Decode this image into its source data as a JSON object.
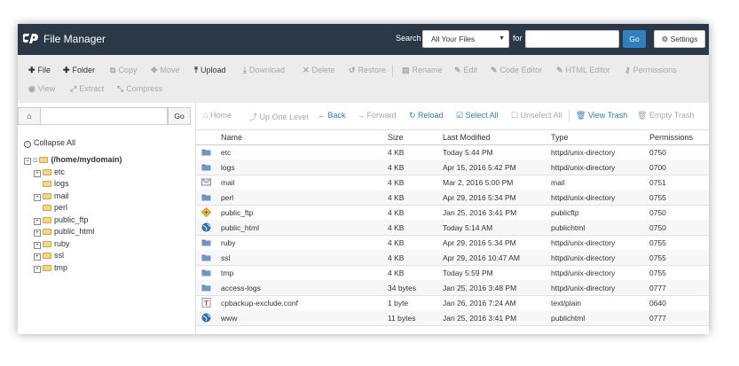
{
  "app": {
    "title": "File Manager",
    "logo": "cpanel-logo"
  },
  "search": {
    "label": "Search",
    "scope_value": "All Your Files",
    "for_label": "for",
    "query": "",
    "go_label": "Go"
  },
  "settings": {
    "label": "Settings",
    "icon": "gear-icon"
  },
  "toolbar": {
    "row1": [
      {
        "icon": "plus-icon",
        "label": "File",
        "enabled": true
      },
      {
        "icon": "plus-icon",
        "label": "Folder",
        "enabled": true
      },
      {
        "icon": "copy-icon",
        "label": "Copy",
        "enabled": false
      },
      {
        "icon": "move-icon",
        "label": "Move",
        "enabled": false
      },
      {
        "icon": "upload-icon",
        "label": "Upload",
        "enabled": true
      },
      {
        "icon": "download-icon",
        "label": "Download",
        "enabled": false
      },
      {
        "icon": "delete-icon",
        "label": "Delete",
        "enabled": false
      },
      {
        "icon": "restore-icon",
        "label": "Restore",
        "enabled": false
      },
      {
        "icon": "rename-icon",
        "label": "Rename",
        "enabled": false
      },
      {
        "icon": "edit-icon",
        "label": "Edit",
        "enabled": false
      },
      {
        "icon": "code-editor-icon",
        "label": "Code Editor",
        "enabled": false
      },
      {
        "icon": "html-editor-icon",
        "label": "HTML Editor",
        "enabled": false
      },
      {
        "icon": "key-icon",
        "label": "Permissions",
        "enabled": false
      }
    ],
    "row2": [
      {
        "icon": "eye-icon",
        "label": "View",
        "enabled": false
      },
      {
        "icon": "extract-icon",
        "label": "Extract",
        "enabled": false
      },
      {
        "icon": "compress-icon",
        "label": "Compress",
        "enabled": false
      }
    ]
  },
  "nav": {
    "path_value": "",
    "go_label": "Go"
  },
  "file_toolbar": [
    {
      "icon": "home-icon",
      "label": "Home",
      "enabled": false
    },
    {
      "icon": "level-up-icon",
      "label": "Up One Level",
      "enabled": false
    },
    {
      "icon": "back-arrow-icon",
      "label": "Back",
      "enabled": true
    },
    {
      "icon": "forward-arrow-icon",
      "label": "Forward",
      "enabled": false
    },
    {
      "icon": "reload-icon",
      "label": "Reload",
      "enabled": true
    },
    {
      "icon": "checkbox-checked-icon",
      "label": "Select All",
      "enabled": true
    },
    {
      "icon": "checkbox-empty-icon",
      "label": "Unselect All",
      "enabled": false
    },
    {
      "icon": "trash-icon",
      "label": "View Trash",
      "enabled": true
    },
    {
      "icon": "trash-icon",
      "label": "Empty Trash",
      "enabled": false
    }
  ],
  "tree": {
    "collapse_all": "Collapse All",
    "root": "(/home/mydomain)",
    "items": [
      {
        "name": "etc",
        "expandable": true
      },
      {
        "name": "logs",
        "expandable": false
      },
      {
        "name": "mail",
        "expandable": true
      },
      {
        "name": "perl",
        "expandable": false
      },
      {
        "name": "public_ftp",
        "expandable": true
      },
      {
        "name": "public_html",
        "expandable": true
      },
      {
        "name": "ruby",
        "expandable": true
      },
      {
        "name": "ssl",
        "expandable": true
      },
      {
        "name": "tmp",
        "expandable": true
      }
    ]
  },
  "table": {
    "columns": [
      "Name",
      "Size",
      "Last Modified",
      "Type",
      "Permissions"
    ],
    "rows": [
      {
        "icon": "folder-icon",
        "name": "etc",
        "size": "4 KB",
        "modified": "Today 5:44 PM",
        "type": "httpd/unix-directory",
        "perms": "0750"
      },
      {
        "icon": "folder-icon",
        "name": "logs",
        "size": "4 KB",
        "modified": "Apr 15, 2016 5:42 PM",
        "type": "httpd/unix-directory",
        "perms": "0700"
      },
      {
        "icon": "mail-icon",
        "name": "mail",
        "size": "4 KB",
        "modified": "Mar 2, 2016 5:00 PM",
        "type": "mail",
        "perms": "0751"
      },
      {
        "icon": "folder-icon",
        "name": "perl",
        "size": "4 KB",
        "modified": "Apr 29, 2016 5:34 PM",
        "type": "httpd/unix-directory",
        "perms": "0755"
      },
      {
        "icon": "ftp-icon",
        "name": "public_ftp",
        "size": "4 KB",
        "modified": "Jan 25, 2016 3:41 PM",
        "type": "publicftp",
        "perms": "0750"
      },
      {
        "icon": "globe-icon",
        "name": "public_html",
        "size": "4 KB",
        "modified": "Today 5:14 AM",
        "type": "publichtml",
        "perms": "0750"
      },
      {
        "icon": "folder-icon",
        "name": "ruby",
        "size": "4 KB",
        "modified": "Apr 29, 2016 5:34 PM",
        "type": "httpd/unix-directory",
        "perms": "0755"
      },
      {
        "icon": "folder-icon",
        "name": "ssl",
        "size": "4 KB",
        "modified": "Apr 29, 2016 10:47 AM",
        "type": "httpd/unix-directory",
        "perms": "0755"
      },
      {
        "icon": "folder-icon",
        "name": "tmp",
        "size": "4 KB",
        "modified": "Today 5:59 PM",
        "type": "httpd/unix-directory",
        "perms": "0755"
      },
      {
        "icon": "folder-icon",
        "name": "access-logs",
        "size": "34 bytes",
        "modified": "Jan 25, 2016 3:48 PM",
        "type": "httpd/unix-directory",
        "perms": "0777"
      },
      {
        "icon": "text-file-icon",
        "name": "cpbackup-exclude.conf",
        "size": "1 byte",
        "modified": "Jan 26, 2016 7:24 AM",
        "type": "text/plain",
        "perms": "0640"
      },
      {
        "icon": "globe-icon",
        "name": "www",
        "size": "11 bytes",
        "modified": "Jan 25, 2016 3:41 PM",
        "type": "publichtml",
        "perms": "0777"
      }
    ]
  },
  "colors": {
    "header_bg": "#2a3847",
    "accent": "#2f7fc1",
    "folder": "#f5d58a",
    "disabled": "#a8a8a8"
  }
}
